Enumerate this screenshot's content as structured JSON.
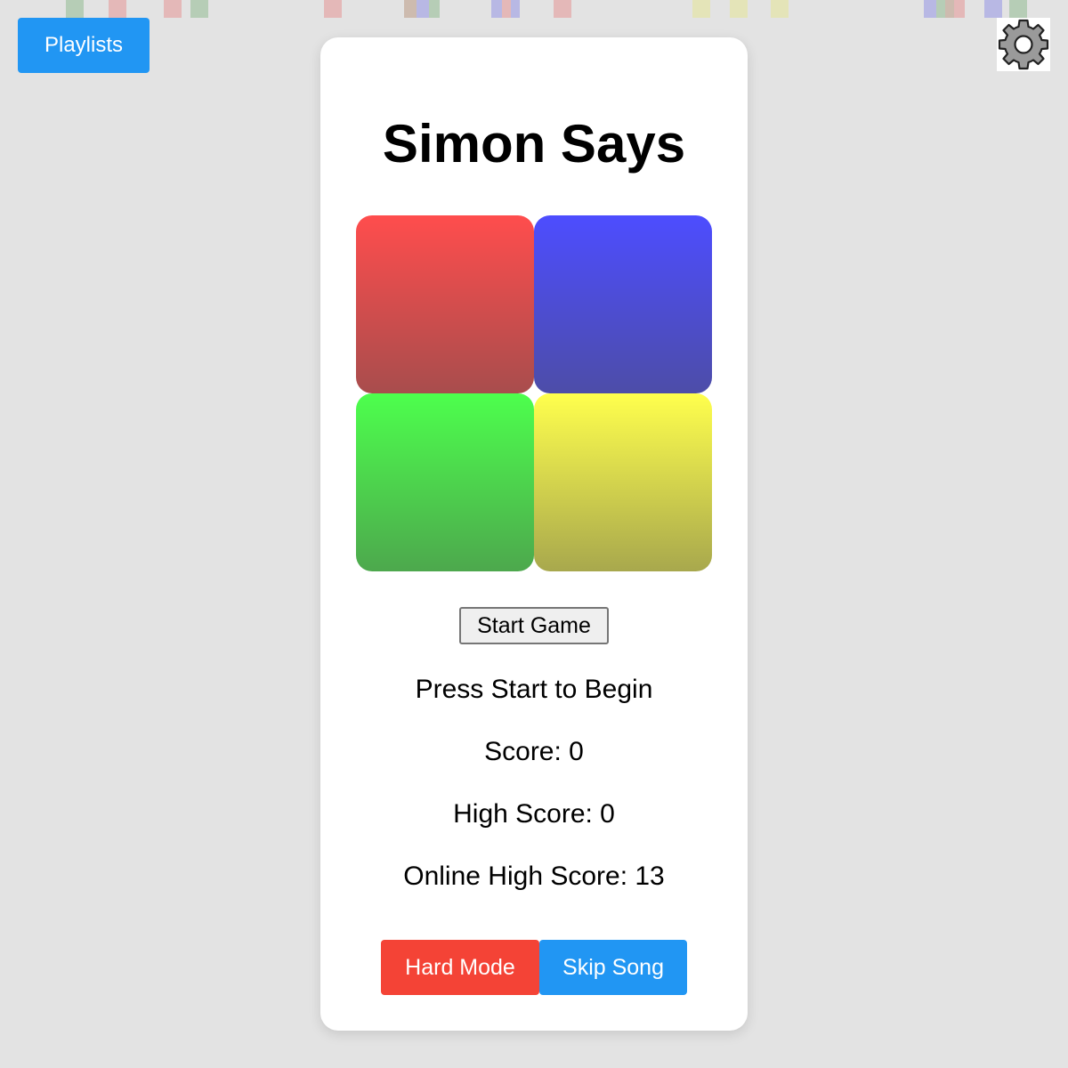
{
  "header": {
    "playlists_label": "Playlists",
    "settings_icon": "gear-icon"
  },
  "game": {
    "title": "Simon Says",
    "pads": [
      {
        "name": "red",
        "color": "#ff4d4d"
      },
      {
        "name": "blue",
        "color": "#4d4dff"
      },
      {
        "name": "green",
        "color": "#4dff4d"
      },
      {
        "name": "yellow",
        "color": "#ffff4d"
      }
    ],
    "start_label": "Start Game",
    "status": "Press Start to Begin",
    "score": "Score: 0",
    "high_score": "High Score: 0",
    "online_high_score": "Online High Score: 13"
  },
  "footer": {
    "hard_mode_label": "Hard Mode",
    "skip_song_label": "Skip Song"
  },
  "colors": {
    "background": "#e3e3e3",
    "accent_blue": "#2196f3",
    "accent_red": "#f44336"
  }
}
